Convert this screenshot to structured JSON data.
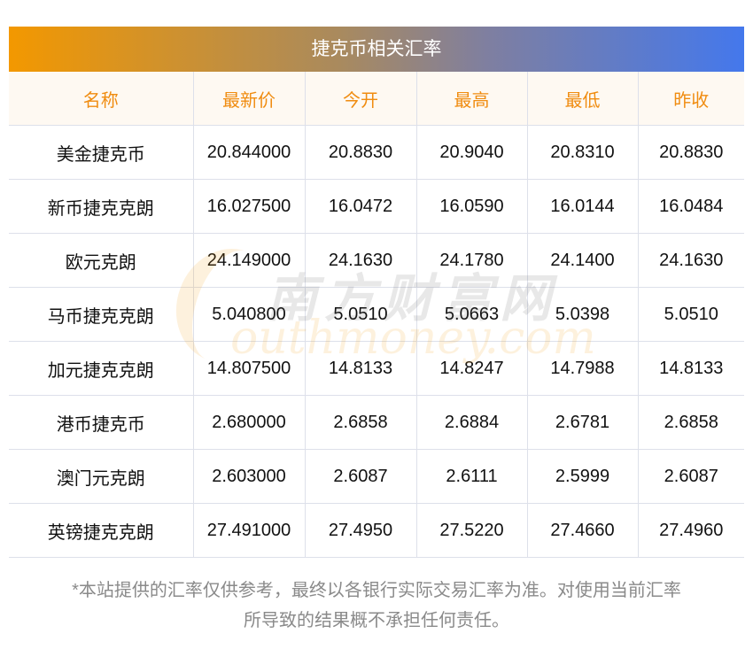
{
  "title": "捷克币相关汇率",
  "columns": [
    "名称",
    "最新价",
    "今开",
    "最高",
    "最低",
    "昨收"
  ],
  "rows": [
    [
      "美金捷克币",
      "20.844000",
      "20.8830",
      "20.9040",
      "20.8310",
      "20.8830"
    ],
    [
      "新币捷克克朗",
      "16.027500",
      "16.0472",
      "16.0590",
      "16.0144",
      "16.0484"
    ],
    [
      "欧元克朗",
      "24.149000",
      "24.1630",
      "24.1780",
      "24.1400",
      "24.1630"
    ],
    [
      "马币捷克克朗",
      "5.040800",
      "5.0510",
      "5.0663",
      "5.0398",
      "5.0510"
    ],
    [
      "加元捷克克朗",
      "14.807500",
      "14.8133",
      "14.8247",
      "14.7988",
      "14.8133"
    ],
    [
      "港币捷克币",
      "2.680000",
      "2.6858",
      "2.6884",
      "2.6781",
      "2.6858"
    ],
    [
      "澳门元克朗",
      "2.603000",
      "2.6087",
      "2.6111",
      "2.5999",
      "2.6087"
    ],
    [
      "英镑捷克克朗",
      "27.491000",
      "27.4950",
      "27.5220",
      "27.4660",
      "27.4960"
    ]
  ],
  "note_line1": "*本站提供的汇率仅供参考，最终以各银行实际交易汇率为准。对使用当前汇率",
  "note_line2": "所导致的结果概不承担任何责任。",
  "watermark": {
    "cn": "南方财富网",
    "en": "outhmoney.com"
  },
  "colors": {
    "header_text": "#f08c10",
    "gradient_start": "#f39800",
    "gradient_end": "#4478ec"
  }
}
